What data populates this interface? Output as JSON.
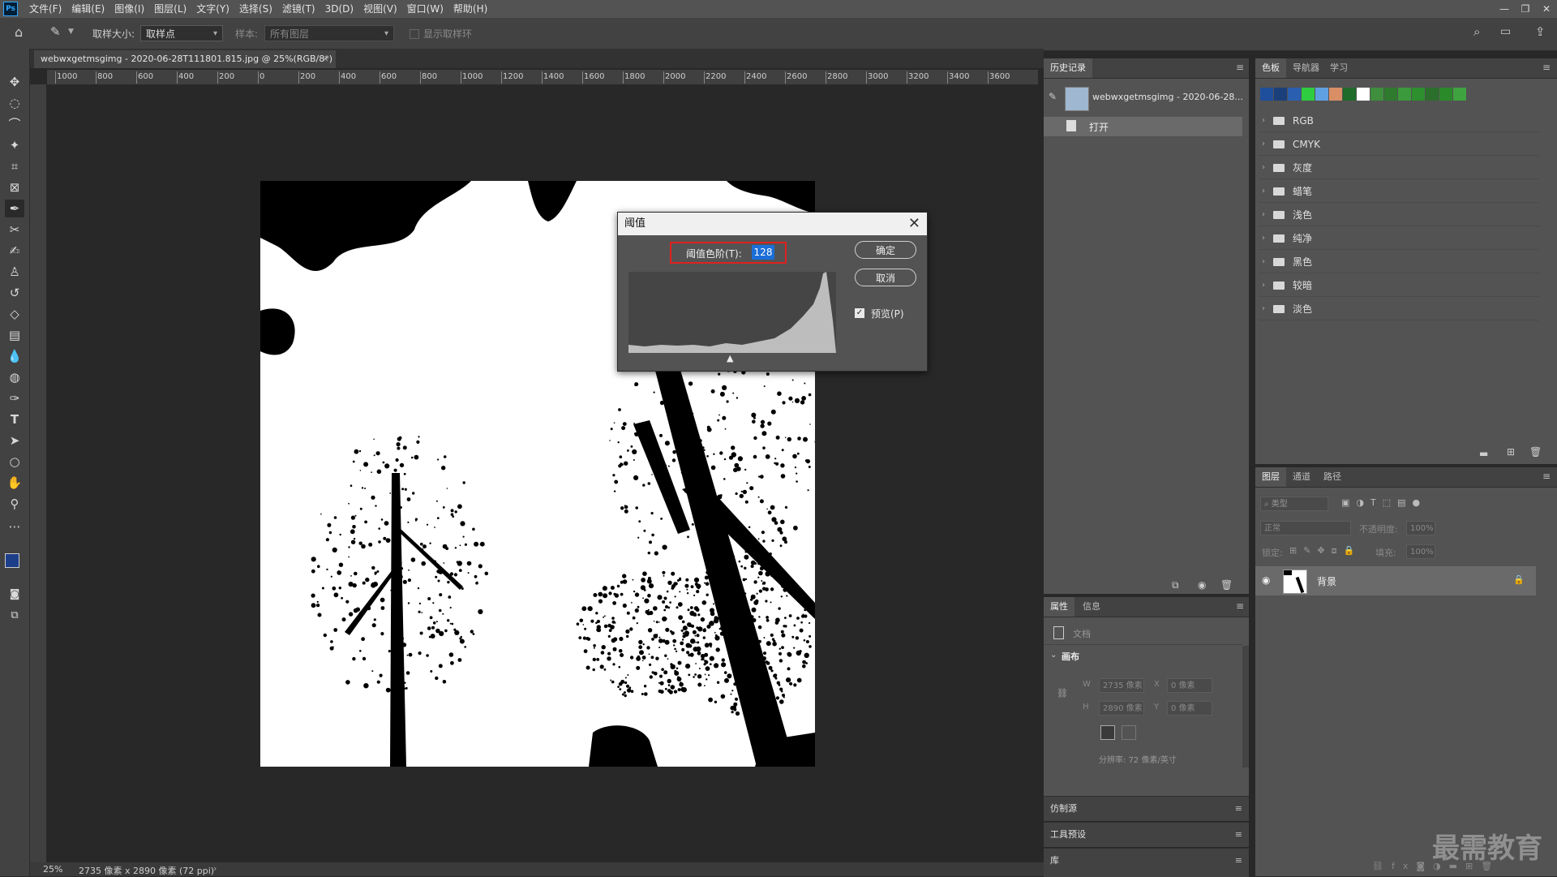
{
  "app": {
    "logo": "Ps",
    "menu": [
      "文件(F)",
      "编辑(E)",
      "图像(I)",
      "图层(L)",
      "文字(Y)",
      "选择(S)",
      "滤镜(T)",
      "3D(D)",
      "视图(V)",
      "窗口(W)",
      "帮助(H)"
    ],
    "window_controls": [
      "—",
      "❐",
      "✕"
    ]
  },
  "options_bar": {
    "sample_size_label": "取样大小:",
    "sample_size_value": "取样点",
    "sample_label": "样本:",
    "sample_value": "所有图层",
    "show_ring_label": "显示取样环"
  },
  "document": {
    "tab_title": "webwxgetmsgimg - 2020-06-28T111801.815.jpg @ 25%(RGB/8*)",
    "tab_close": "×",
    "ruler_ticks": [
      "1000",
      "800",
      "600",
      "400",
      "200",
      "0",
      "200",
      "400",
      "600",
      "800",
      "1000",
      "1200",
      "1400",
      "1600",
      "1800",
      "2000",
      "2200",
      "2400",
      "2600",
      "2800",
      "3000",
      "3200",
      "3400",
      "3600"
    ],
    "zoom": "25%",
    "dimensions": "2735 像素 x 2890 像素 (72 ppi)"
  },
  "threshold_dialog": {
    "title": "阈值",
    "level_label": "阈值色阶(T):",
    "level_value": "128",
    "ok_label": "确定",
    "cancel_label": "取消",
    "preview_label": "预览(P)",
    "preview_checked": true,
    "highlight_color": "#e0201e"
  },
  "history_panel": {
    "tab": "历史记录",
    "snapshot_name": "webwxgetmsgimg - 2020-06-28...",
    "states": [
      "打开"
    ]
  },
  "properties_panel": {
    "tabs": [
      "属性",
      "信息"
    ],
    "doc_label": "文档",
    "section": "画布",
    "w_label": "W",
    "w_value": "2735 像素",
    "h_label": "H",
    "h_value": "2890 像素",
    "x_label": "X",
    "x_value": "0 像素",
    "y_label": "Y",
    "y_value": "0 像素",
    "resolution": "分辨率: 72 像素/英寸"
  },
  "collapsed_panels": [
    "仿制源",
    "工具预设",
    "库"
  ],
  "swatches_panel": {
    "tabs": [
      "色板",
      "导航器",
      "学习"
    ],
    "recent_colors": [
      "#1f4e9c",
      "#1b3f7a",
      "#2a5fb0",
      "#2ecc40",
      "#5ea0e0",
      "#d98e66",
      "#1e6b2a",
      "#ffffff",
      "#3e8e3e",
      "#2f7a2f",
      "#3b9a3b",
      "#2d8f2d",
      "#2c6f2c",
      "#2a8a2a",
      "#3fa33f"
    ],
    "groups": [
      "RGB",
      "CMYK",
      "灰度",
      "蜡笔",
      "浅色",
      "纯净",
      "黑色",
      "较暗",
      "淡色"
    ]
  },
  "layers_panel": {
    "tabs": [
      "图层",
      "通道",
      "路径"
    ],
    "filter_placeholder": "类型",
    "blend_mode": "正常",
    "opacity_label": "不透明度:",
    "opacity_value": "100%",
    "lock_label": "锁定:",
    "fill_label": "填充:",
    "fill_value": "100%",
    "layer_name": "背景"
  },
  "colors": {
    "foreground": "#1d3f8a",
    "background": "#3dbd3d"
  },
  "watermark": "最需教育"
}
